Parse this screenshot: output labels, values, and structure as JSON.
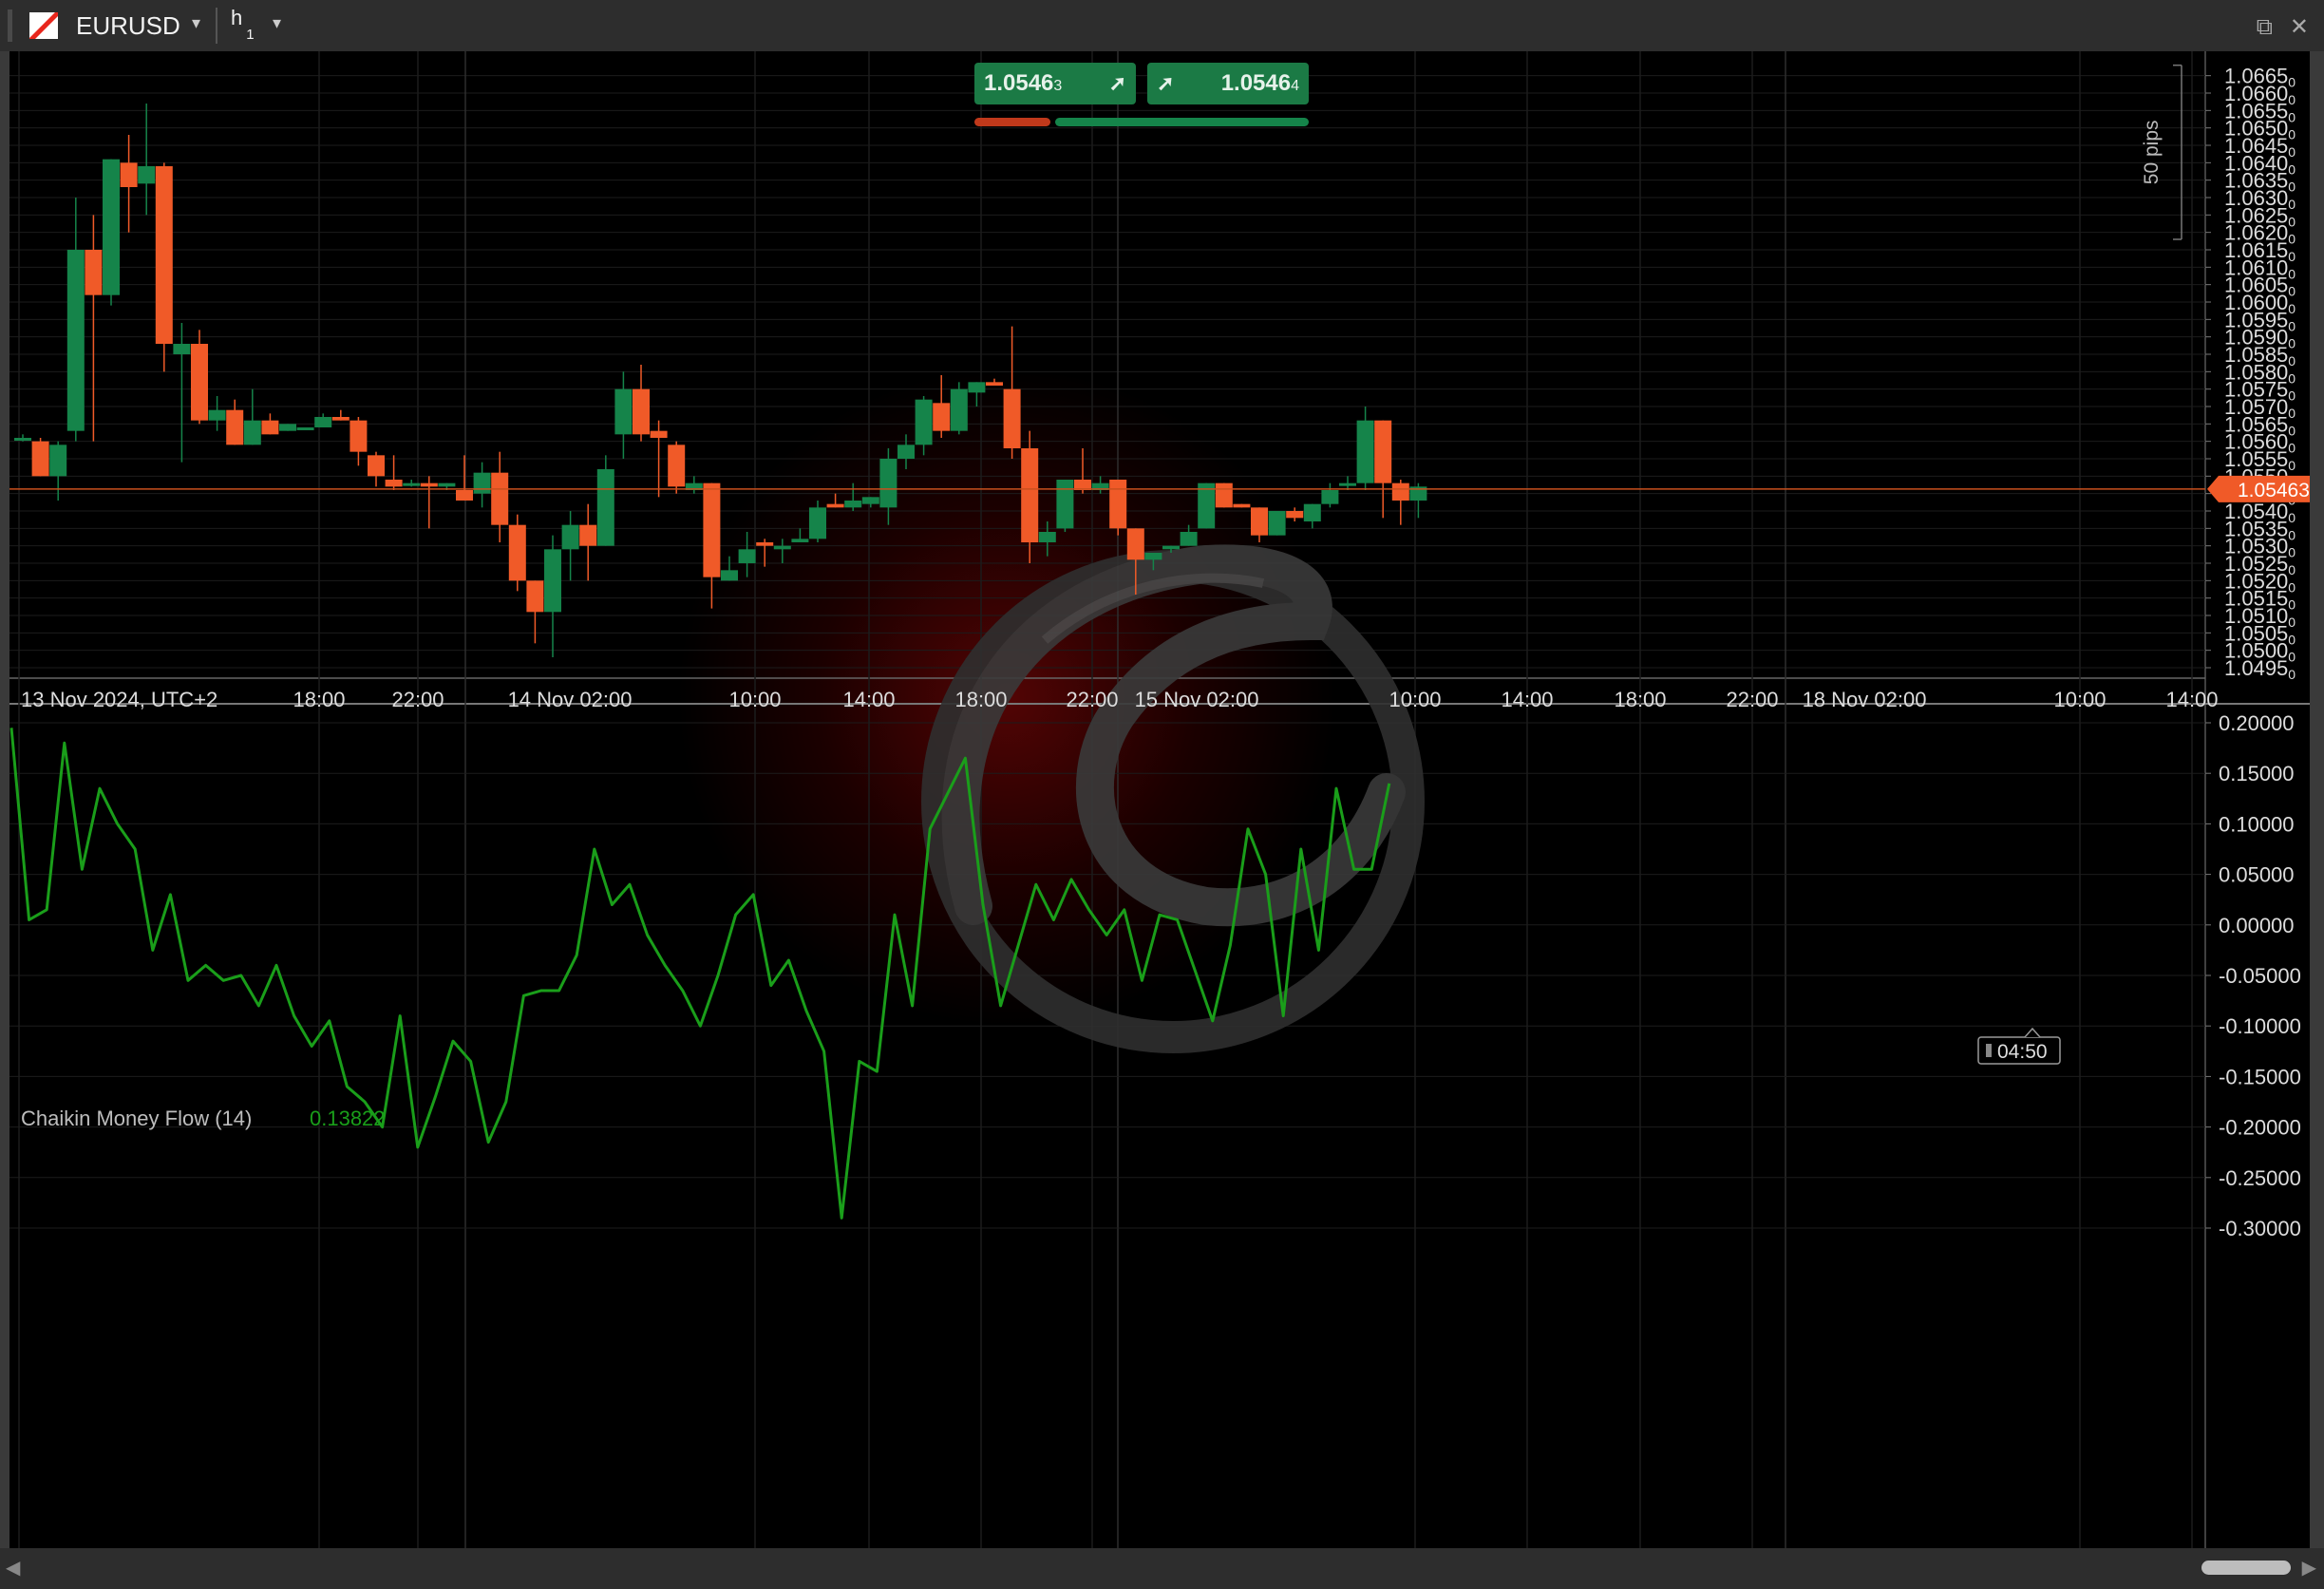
{
  "window": {
    "symbol": "EURUSD",
    "timeframe": "h",
    "timeframe_sub": "1",
    "dropdown_glyph": "▾",
    "popout_glyph": "⧉",
    "close_glyph": "✕"
  },
  "quote": {
    "sell_main": "1.0546",
    "sell_pip": "3",
    "buy_main": "1.0546",
    "buy_pip": "4",
    "arrow": "➚",
    "sell_color": "#1b7a45",
    "buy_color": "#1b7a45",
    "bar_red": "#c0391b",
    "bar_green": "#15844a"
  },
  "price_axis": {
    "labels": [
      "1.0665",
      "1.0660",
      "1.0655",
      "1.0650",
      "1.0645",
      "1.0640",
      "1.0635",
      "1.0630",
      "1.0625",
      "1.0620",
      "1.0615",
      "1.0610",
      "1.0605",
      "1.0600",
      "1.0595",
      "1.0590",
      "1.0585",
      "1.0580",
      "1.0575",
      "1.0570",
      "1.0565",
      "1.0560",
      "1.0555",
      "1.0550",
      "1.0545",
      "1.0540",
      "1.0535",
      "1.0530",
      "1.0525",
      "1.0520",
      "1.0515",
      "1.0510",
      "1.0505",
      "1.0500",
      "1.0495"
    ],
    "pipette": "0",
    "current_price": "1.05463",
    "current_value": 1.05463,
    "pips_label": "50 pips",
    "ylim": [
      1.0492,
      1.0672
    ],
    "current_color": "#f05a28"
  },
  "time_axis": {
    "labels": [
      "13 Nov 2024, UTC+2",
      "18:00",
      "22:00",
      "14 Nov 02:00",
      "10:00",
      "14:00",
      "18:00",
      "22:00",
      "15 Nov 02:00",
      "10:00",
      "14:00",
      "18:00",
      "22:00",
      "18 Nov 02:00",
      "10:00",
      "14:00"
    ],
    "countdown": "04:50"
  },
  "indicator": {
    "name": "Chaikin Money Flow (14)",
    "value": "0.13822",
    "axis_labels": [
      "0.20000",
      "0.15000",
      "0.10000",
      "0.05000",
      "0.00000",
      "-0.05000",
      "-0.10000",
      "-0.15000",
      "-0.20000",
      "-0.25000",
      "-0.30000"
    ],
    "ylim": [
      -0.3,
      0.2
    ],
    "line_color": "#1a9e1a"
  },
  "scroll": {
    "left_glyph": "◀",
    "right_glyph": "▶"
  },
  "chart_data": [
    {
      "type": "candlestick",
      "symbol": "EURUSD",
      "timeframe": "h1",
      "up_color": "#15844a",
      "down_color": "#f05a28",
      "ylim": [
        1.0492,
        1.0672
      ],
      "candles": [
        {
          "o": 1.0561,
          "h": 1.0562,
          "l": 1.056,
          "c": 1.0561
        },
        {
          "o": 1.056,
          "h": 1.0561,
          "l": 1.055,
          "c": 1.055
        },
        {
          "o": 1.055,
          "h": 1.056,
          "l": 1.0543,
          "c": 1.0559
        },
        {
          "o": 1.0563,
          "h": 1.063,
          "l": 1.056,
          "c": 1.0615
        },
        {
          "o": 1.0615,
          "h": 1.0625,
          "l": 1.056,
          "c": 1.0602
        },
        {
          "o": 1.0602,
          "h": 1.0641,
          "l": 1.0599,
          "c": 1.0641
        },
        {
          "o": 1.064,
          "h": 1.0648,
          "l": 1.062,
          "c": 1.0633
        },
        {
          "o": 1.0634,
          "h": 1.0657,
          "l": 1.0625,
          "c": 1.0639
        },
        {
          "o": 1.0639,
          "h": 1.064,
          "l": 1.058,
          "c": 1.0588
        },
        {
          "o": 1.0585,
          "h": 1.0594,
          "l": 1.0554,
          "c": 1.0588
        },
        {
          "o": 1.0588,
          "h": 1.0592,
          "l": 1.0565,
          "c": 1.0566
        },
        {
          "o": 1.0566,
          "h": 1.0573,
          "l": 1.0563,
          "c": 1.0569
        },
        {
          "o": 1.0569,
          "h": 1.0572,
          "l": 1.0559,
          "c": 1.0559
        },
        {
          "o": 1.0559,
          "h": 1.0575,
          "l": 1.0559,
          "c": 1.0566
        },
        {
          "o": 1.0566,
          "h": 1.0568,
          "l": 1.0562,
          "c": 1.0562
        },
        {
          "o": 1.0563,
          "h": 1.0565,
          "l": 1.0563,
          "c": 1.0565
        },
        {
          "o": 1.0564,
          "h": 1.0564,
          "l": 1.0564,
          "c": 1.0564
        },
        {
          "o": 1.0564,
          "h": 1.0568,
          "l": 1.0564,
          "c": 1.0567
        },
        {
          "o": 1.0567,
          "h": 1.0569,
          "l": 1.0566,
          "c": 1.0566
        },
        {
          "o": 1.0566,
          "h": 1.0567,
          "l": 1.0553,
          "c": 1.0557
        },
        {
          "o": 1.0556,
          "h": 1.0557,
          "l": 1.0547,
          "c": 1.055
        },
        {
          "o": 1.0549,
          "h": 1.0556,
          "l": 1.0546,
          "c": 1.0547
        },
        {
          "o": 1.0548,
          "h": 1.0549,
          "l": 1.0547,
          "c": 1.0548
        },
        {
          "o": 1.0548,
          "h": 1.055,
          "l": 1.0535,
          "c": 1.0547
        },
        {
          "o": 1.0547,
          "h": 1.0548,
          "l": 1.0546,
          "c": 1.0548
        },
        {
          "o": 1.0546,
          "h": 1.0556,
          "l": 1.0543,
          "c": 1.0543
        },
        {
          "o": 1.0545,
          "h": 1.0554,
          "l": 1.0541,
          "c": 1.0551
        },
        {
          "o": 1.0551,
          "h": 1.0557,
          "l": 1.0531,
          "c": 1.0536
        },
        {
          "o": 1.0536,
          "h": 1.0539,
          "l": 1.0517,
          "c": 1.052
        },
        {
          "o": 1.052,
          "h": 1.052,
          "l": 1.0502,
          "c": 1.0511
        },
        {
          "o": 1.0511,
          "h": 1.0533,
          "l": 1.0498,
          "c": 1.0529
        },
        {
          "o": 1.0529,
          "h": 1.054,
          "l": 1.052,
          "c": 1.0536
        },
        {
          "o": 1.0536,
          "h": 1.0542,
          "l": 1.052,
          "c": 1.053
        },
        {
          "o": 1.053,
          "h": 1.0556,
          "l": 1.053,
          "c": 1.0552
        },
        {
          "o": 1.0562,
          "h": 1.058,
          "l": 1.0555,
          "c": 1.0575
        },
        {
          "o": 1.0575,
          "h": 1.0582,
          "l": 1.056,
          "c": 1.0562
        },
        {
          "o": 1.0563,
          "h": 1.0566,
          "l": 1.0544,
          "c": 1.0561
        },
        {
          "o": 1.0559,
          "h": 1.056,
          "l": 1.0545,
          "c": 1.0547
        },
        {
          "o": 1.0546,
          "h": 1.055,
          "l": 1.0545,
          "c": 1.0548
        },
        {
          "o": 1.0548,
          "h": 1.0548,
          "l": 1.0512,
          "c": 1.0521
        },
        {
          "o": 1.052,
          "h": 1.0527,
          "l": 1.052,
          "c": 1.0523
        },
        {
          "o": 1.0525,
          "h": 1.0534,
          "l": 1.0521,
          "c": 1.0529
        },
        {
          "o": 1.0531,
          "h": 1.0532,
          "l": 1.0524,
          "c": 1.053
        },
        {
          "o": 1.0529,
          "h": 1.0532,
          "l": 1.0525,
          "c": 1.053
        },
        {
          "o": 1.0531,
          "h": 1.0535,
          "l": 1.0531,
          "c": 1.0532
        },
        {
          "o": 1.0532,
          "h": 1.0543,
          "l": 1.0531,
          "c": 1.0541
        },
        {
          "o": 1.0542,
          "h": 1.0545,
          "l": 1.0541,
          "c": 1.0541
        },
        {
          "o": 1.0541,
          "h": 1.0548,
          "l": 1.054,
          "c": 1.0543
        },
        {
          "o": 1.0542,
          "h": 1.0544,
          "l": 1.0541,
          "c": 1.0544
        },
        {
          "o": 1.0541,
          "h": 1.0558,
          "l": 1.0536,
          "c": 1.0555
        },
        {
          "o": 1.0555,
          "h": 1.0562,
          "l": 1.0552,
          "c": 1.0559
        },
        {
          "o": 1.0559,
          "h": 1.0573,
          "l": 1.0556,
          "c": 1.0572
        },
        {
          "o": 1.0571,
          "h": 1.0579,
          "l": 1.0561,
          "c": 1.0563
        },
        {
          "o": 1.0563,
          "h": 1.0577,
          "l": 1.0562,
          "c": 1.0575
        },
        {
          "o": 1.0574,
          "h": 1.0577,
          "l": 1.057,
          "c": 1.0577
        },
        {
          "o": 1.0577,
          "h": 1.0578,
          "l": 1.0576,
          "c": 1.0576
        },
        {
          "o": 1.0575,
          "h": 1.0593,
          "l": 1.0555,
          "c": 1.0558
        },
        {
          "o": 1.0558,
          "h": 1.0563,
          "l": 1.0525,
          "c": 1.0531
        },
        {
          "o": 1.0531,
          "h": 1.0537,
          "l": 1.0527,
          "c": 1.0534
        },
        {
          "o": 1.0535,
          "h": 1.0549,
          "l": 1.0534,
          "c": 1.0549
        },
        {
          "o": 1.0549,
          "h": 1.0558,
          "l": 1.0545,
          "c": 1.0546
        },
        {
          "o": 1.0546,
          "h": 1.055,
          "l": 1.0545,
          "c": 1.0548
        },
        {
          "o": 1.0549,
          "h": 1.0549,
          "l": 1.0533,
          "c": 1.0535
        },
        {
          "o": 1.0535,
          "h": 1.0535,
          "l": 1.0516,
          "c": 1.0526
        },
        {
          "o": 1.0526,
          "h": 1.0528,
          "l": 1.0523,
          "c": 1.0528
        },
        {
          "o": 1.0529,
          "h": 1.053,
          "l": 1.0528,
          "c": 1.053
        },
        {
          "o": 1.053,
          "h": 1.0536,
          "l": 1.053,
          "c": 1.0534
        },
        {
          "o": 1.0535,
          "h": 1.0548,
          "l": 1.0535,
          "c": 1.0548
        },
        {
          "o": 1.0548,
          "h": 1.0548,
          "l": 1.0541,
          "c": 1.0541
        },
        {
          "o": 1.0542,
          "h": 1.0542,
          "l": 1.0541,
          "c": 1.0541
        },
        {
          "o": 1.0541,
          "h": 1.0541,
          "l": 1.0531,
          "c": 1.0533
        },
        {
          "o": 1.0533,
          "h": 1.054,
          "l": 1.0533,
          "c": 1.054
        },
        {
          "o": 1.054,
          "h": 1.0541,
          "l": 1.0537,
          "c": 1.0538
        },
        {
          "o": 1.0537,
          "h": 1.0542,
          "l": 1.0535,
          "c": 1.0542
        },
        {
          "o": 1.0542,
          "h": 1.0548,
          "l": 1.0541,
          "c": 1.0546
        },
        {
          "o": 1.0548,
          "h": 1.055,
          "l": 1.0546,
          "c": 1.0548
        },
        {
          "o": 1.0548,
          "h": 1.057,
          "l": 1.0546,
          "c": 1.0566
        },
        {
          "o": 1.0566,
          "h": 1.0566,
          "l": 1.0538,
          "c": 1.0548
        },
        {
          "o": 1.0548,
          "h": 1.0549,
          "l": 1.0536,
          "c": 1.0543
        },
        {
          "o": 1.0543,
          "h": 1.0548,
          "l": 1.0538,
          "c": 1.0547
        }
      ]
    },
    {
      "type": "line",
      "title": "Chaikin Money Flow (14)",
      "ylim": [
        -0.3,
        0.2
      ],
      "values": [
        0.195,
        0.005,
        0.015,
        0.18,
        0.055,
        0.135,
        0.1,
        0.075,
        -0.025,
        0.03,
        -0.055,
        -0.04,
        -0.055,
        -0.05,
        -0.08,
        -0.04,
        -0.09,
        -0.12,
        -0.095,
        -0.16,
        -0.175,
        -0.2,
        -0.09,
        -0.22,
        -0.17,
        -0.115,
        -0.135,
        -0.215,
        -0.175,
        -0.07,
        -0.065,
        -0.065,
        -0.03,
        0.075,
        0.02,
        0.04,
        -0.01,
        -0.04,
        -0.065,
        -0.1,
        -0.05,
        0.01,
        0.03,
        -0.06,
        -0.035,
        -0.085,
        -0.125,
        -0.29,
        -0.135,
        -0.145,
        0.01,
        -0.08,
        0.095,
        0.13,
        0.165,
        0.02,
        -0.08,
        -0.02,
        0.04,
        0.005,
        0.045,
        0.015,
        -0.01,
        0.015,
        -0.055,
        0.01,
        0.005,
        -0.045,
        -0.095,
        -0.02,
        0.095,
        0.05,
        -0.09,
        0.075,
        -0.025,
        0.135,
        0.055,
        0.055,
        0.14
      ]
    }
  ]
}
